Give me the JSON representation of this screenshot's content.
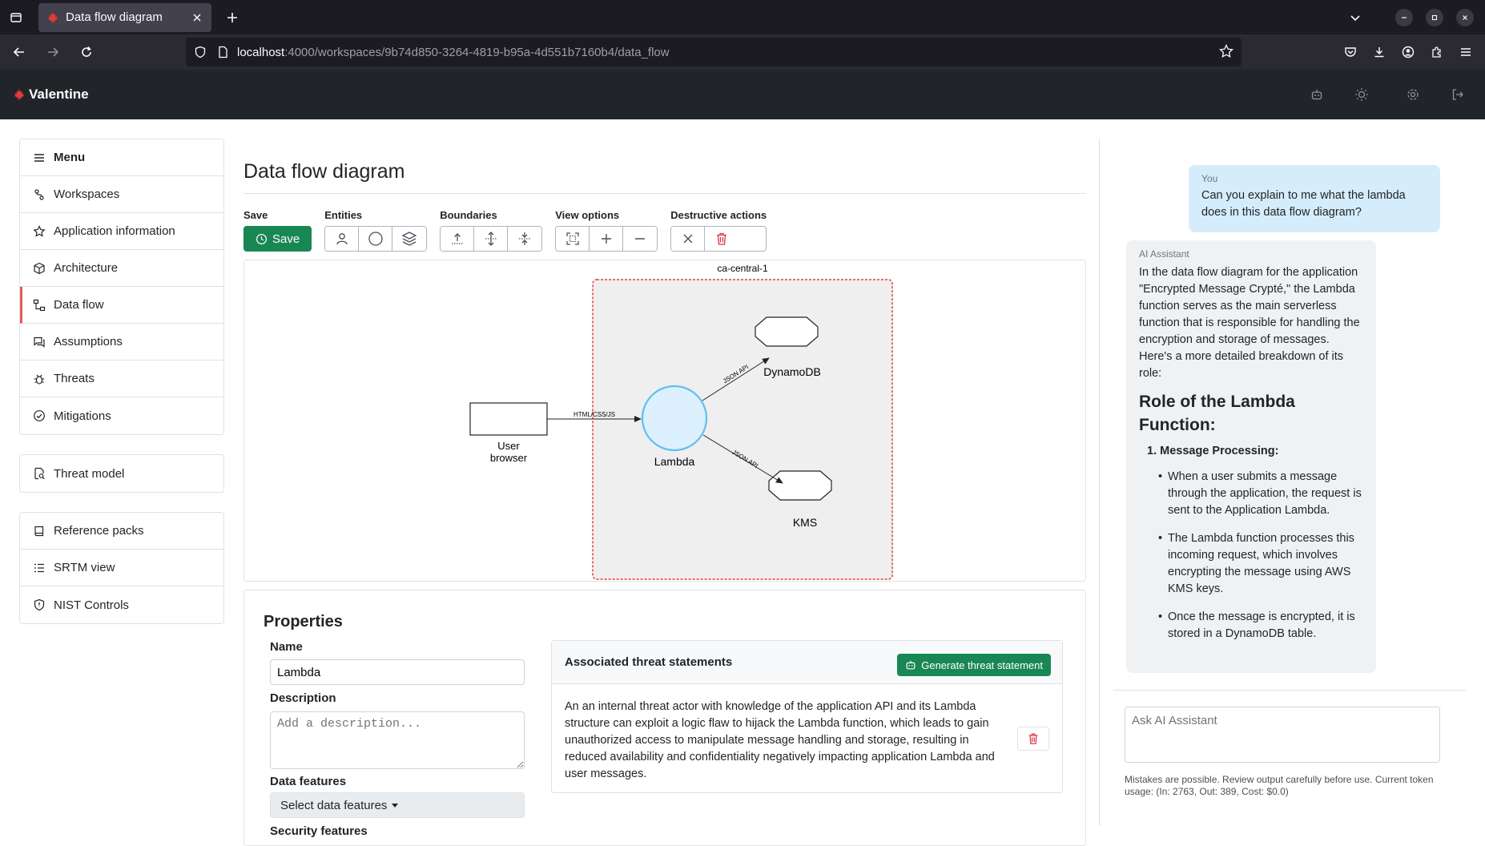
{
  "browser": {
    "tab_title": "Data flow diagram",
    "url_host": "localhost",
    "url_path": ":4000/workspaces/9b74d850-3264-4819-b95a-4d551b7160b4/data_flow"
  },
  "app": {
    "brand": "Valentine",
    "brand_color": "#d32f2f"
  },
  "sidebar": {
    "menu_label": "Menu",
    "items": [
      {
        "label": "Workspaces",
        "icon": "route-icon"
      },
      {
        "label": "Application information",
        "icon": "star-icon"
      },
      {
        "label": "Architecture",
        "icon": "box-icon"
      },
      {
        "label": "Data flow",
        "icon": "flow-icon",
        "active": true
      },
      {
        "label": "Assumptions",
        "icon": "chat-icon"
      },
      {
        "label": "Threats",
        "icon": "bug-icon"
      },
      {
        "label": "Mitigations",
        "icon": "check-circle-icon"
      }
    ],
    "threat_model": {
      "label": "Threat model",
      "icon": "doc-search-icon"
    },
    "references": [
      {
        "label": "Reference packs",
        "icon": "book-icon"
      },
      {
        "label": "SRTM view",
        "icon": "list-icon"
      },
      {
        "label": "NIST Controls",
        "icon": "shield-icon"
      }
    ]
  },
  "page": {
    "title": "Data flow diagram"
  },
  "toolbar": {
    "save_group": "Save",
    "save_label": "Save",
    "entities_group": "Entities",
    "boundaries_group": "Boundaries",
    "view_group": "View options",
    "destructive_group": "Destructive actions"
  },
  "diagram": {
    "boundary_label": "ca-central-1",
    "actor_label_line1": "User",
    "actor_label_line2": "browser",
    "process_label": "Lambda",
    "store1_label": "DynamoDB",
    "store2_label": "KMS",
    "flow1_label": "HTML/CSS/JS",
    "flow2_label": "JSON API",
    "flow3_label": "JSON API"
  },
  "properties": {
    "heading": "Properties",
    "name_label": "Name",
    "name_value": "Lambda",
    "description_label": "Description",
    "description_placeholder": "Add a description...",
    "data_features_label": "Data features",
    "data_features_select": "Select data features",
    "security_features_label": "Security features"
  },
  "threats": {
    "heading": "Associated threat statements",
    "generate_label": "Generate threat statement",
    "statement": "An an internal threat actor with knowledge of the application API and its Lambda structure can exploit a logic flaw to hijack the Lambda function, which leads to gain unauthorized access to manipulate message handling and storage, resulting in reduced availability and confidentiality negatively impacting application Lambda and user messages."
  },
  "chat": {
    "you_label": "You",
    "you_message": "Can you explain to me what the lambda does in this data flow diagram?",
    "ai_label": "AI Assistant",
    "ai_intro": "In the data flow diagram for the application \"Encrypted Message Crypté,\" the Lambda function serves as the main serverless function that is responsible for handling the encryption and storage of messages. Here's a more detailed breakdown of its role:",
    "ai_heading": "Role of the Lambda Function:",
    "ai_list_title": "1. Message Processing:",
    "ai_bullets": [
      "When a user submits a message through the application, the request is sent to the Application Lambda.",
      "The Lambda function processes this incoming request, which involves encrypting the message using AWS KMS keys.",
      "Once the message is encrypted, it is stored in a DynamoDB table."
    ],
    "input_placeholder": "Ask AI Assistant",
    "disclaimer": "Mistakes are possible. Review output carefully before use. Current token usage: (In: 2763, Out: 389, Cost: $0.0)"
  }
}
